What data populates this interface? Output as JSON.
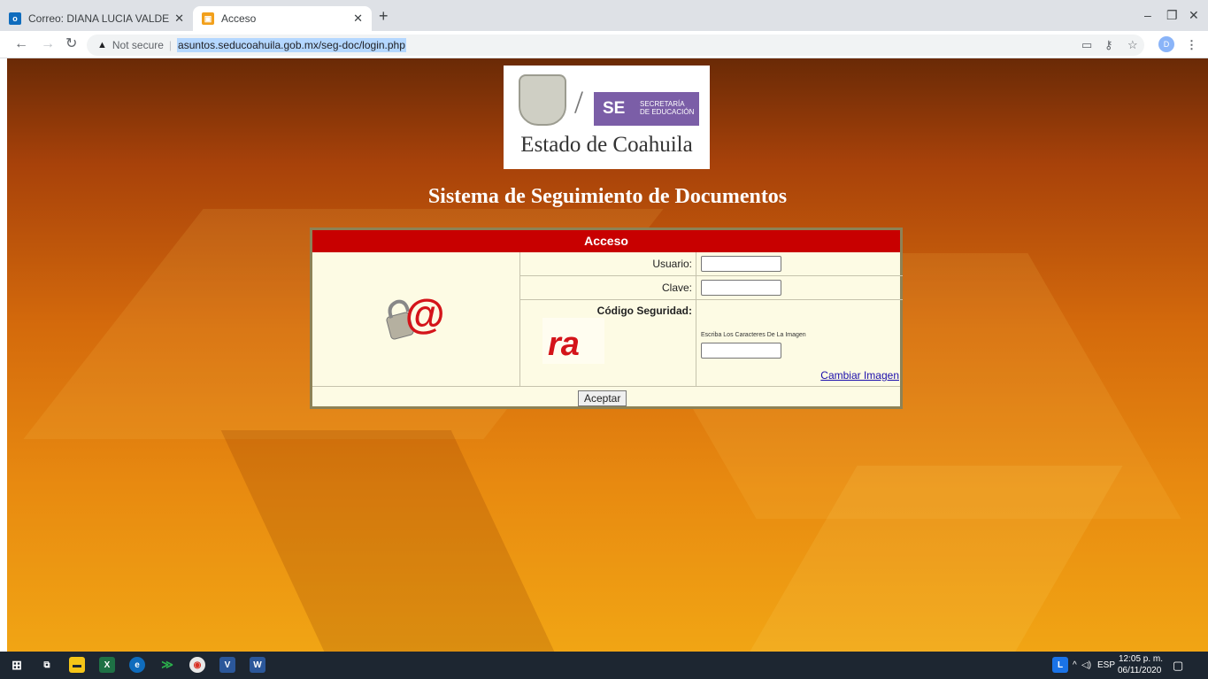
{
  "browser": {
    "tabs": [
      {
        "label": "Correo: DIANA LUCIA VALDES G/",
        "icon": "outlook-icon",
        "color": "#0f6cbd"
      },
      {
        "label": "Acceso",
        "icon": "site-favicon",
        "color": "#f2a01b"
      }
    ],
    "new_tab": "+",
    "close_glyph": "✕",
    "url": {
      "security": "Not secure",
      "text": "asuntos.seducoahuila.gob.mx/seg-doc/login.php"
    },
    "profile_initial": "D",
    "window_controls": {
      "minimize": "–",
      "restore": "❐",
      "close": "✕"
    }
  },
  "page": {
    "logo": {
      "separator": "/",
      "se": "SE",
      "secretaria_line1": "SECRETARÍA",
      "secretaria_line2": "DE EDUCACIÓN",
      "estado": "Estado de Coahuila"
    },
    "title": "Sistema de Seguimiento de Documentos",
    "form": {
      "header": "Acceso",
      "header_color": "#c80000",
      "usuario_label": "Usuario:",
      "clave_label": "Clave:",
      "codigo_label": "Código Seguridad:",
      "cambiar_link": "Cambiar Imagen",
      "escriba_text": "Escriba Los Caracteres De La Imagen",
      "aceptar_button": "Aceptar"
    }
  },
  "taskbar": {
    "lang": "ESP",
    "time": "12:05 p. m.",
    "date": "06/11/2020",
    "app_letter": "L"
  }
}
